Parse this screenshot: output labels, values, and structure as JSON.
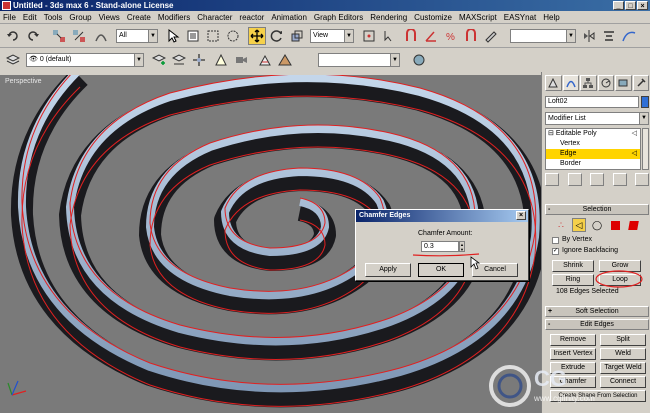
{
  "window": {
    "title": "Untitled - 3ds max 6 - Stand-alone License",
    "buttons": [
      "_",
      "□",
      "×"
    ]
  },
  "menu": [
    "File",
    "Edit",
    "Tools",
    "Group",
    "Views",
    "Create",
    "Modifiers",
    "Character",
    "reactor",
    "Animation",
    "Graph Editors",
    "Rendering",
    "Customize",
    "MAXScript",
    "EASYnat",
    "Help"
  ],
  "toolbar": {
    "selection_filter": "All",
    "ref_coord": "View",
    "layer": "0 (default)",
    "axis": [
      "X",
      "Y",
      "Z",
      "XY"
    ],
    "active_axis": "XY",
    "accent_color": "#f5d04a"
  },
  "viewport": {
    "label": "Perspective",
    "background": "#7a7a7a"
  },
  "command_panel": {
    "object_name": "Loft02",
    "object_color": "#2f6fd6",
    "modifier_list": "Modifier List",
    "stack": [
      {
        "prefix": "⊟",
        "label": "Editable Poly",
        "indent": false,
        "highlight": false
      },
      {
        "prefix": "",
        "label": "Vertex",
        "indent": true,
        "highlight": false
      },
      {
        "prefix": "",
        "label": "Edge",
        "indent": true,
        "highlight": true
      },
      {
        "prefix": "",
        "label": "Border",
        "indent": true,
        "highlight": false
      }
    ],
    "selection": {
      "header": "Selection",
      "by_vertex": "By Vertex",
      "ignore_backfacing": "Ignore Backfacing",
      "ignore_backfacing_checked": "✓",
      "shrink": "Shrink",
      "grow": "Grow",
      "ring": "Ring",
      "loop": "Loop",
      "status": "108 Edges Selected"
    },
    "soft_selection": {
      "header": "Soft Selection",
      "toggle": "+"
    },
    "edit_edges": {
      "header": "Edit Edges",
      "toggle": "-",
      "remove": "Remove",
      "split": "Split",
      "insert_vertex": "Insert Vertex",
      "weld": "Weld",
      "extrude": "Extrude",
      "target_weld": "Target Weld",
      "chamfer": "Chamfer",
      "connect": "Connect",
      "create_shape": "Create Shape From Selection"
    }
  },
  "dialog": {
    "title": "Chamfer Edges",
    "close": "×",
    "amount_label": "Chamfer Amount:",
    "amount_value": "0.3",
    "apply": "Apply",
    "ok": "OK",
    "cancel": "Cancel"
  },
  "watermark": {
    "brand": "CG",
    "site": "www.cgfinity.com"
  },
  "annotation_color": "#e02020"
}
